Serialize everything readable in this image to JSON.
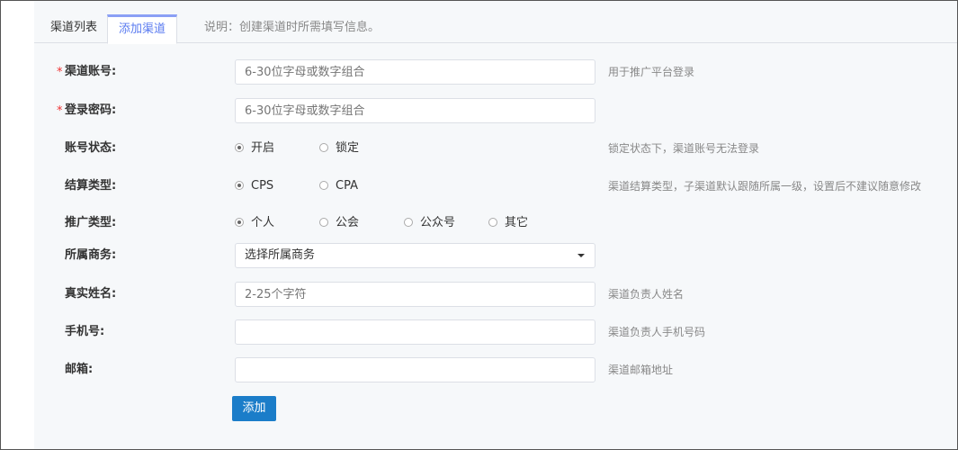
{
  "tabs": {
    "list_label": "渠道列表",
    "add_label": "添加渠道",
    "note": "说明：创建渠道时所需填写信息。"
  },
  "form": {
    "account": {
      "required_mark": "*",
      "label": "渠道账号:",
      "placeholder": "6-30位字母或数字组合",
      "hint": "用于推广平台登录"
    },
    "password": {
      "required_mark": "*",
      "label": "登录密码:",
      "placeholder": "6-30位字母或数字组合"
    },
    "status": {
      "label": "账号状态:",
      "options": [
        "开启",
        "锁定"
      ],
      "selected": "开启",
      "hint": "锁定状态下，渠道账号无法登录"
    },
    "settlement": {
      "label": "结算类型:",
      "options": [
        "CPS",
        "CPA"
      ],
      "selected": "CPS",
      "hint": "渠道结算类型，子渠道默认跟随所属一级，设置后不建议随意修改"
    },
    "promotion": {
      "label": "推广类型:",
      "options": [
        "个人",
        "公会",
        "公众号",
        "其它"
      ],
      "selected": "个人"
    },
    "business": {
      "label": "所属商务:",
      "selected_value": "选择所属商务"
    },
    "real_name": {
      "label": "真实姓名:",
      "placeholder": "2-25个字符",
      "hint": "渠道负责人姓名"
    },
    "phone": {
      "label": "手机号:",
      "value": "",
      "hint": "渠道负责人手机号码"
    },
    "email": {
      "label": "邮箱:",
      "value": "",
      "hint": "渠道邮箱地址"
    },
    "submit_label": "添加"
  },
  "colors": {
    "accent": "#1b7dc9",
    "tab_active": "#5a7bf0",
    "required": "#e33333"
  }
}
